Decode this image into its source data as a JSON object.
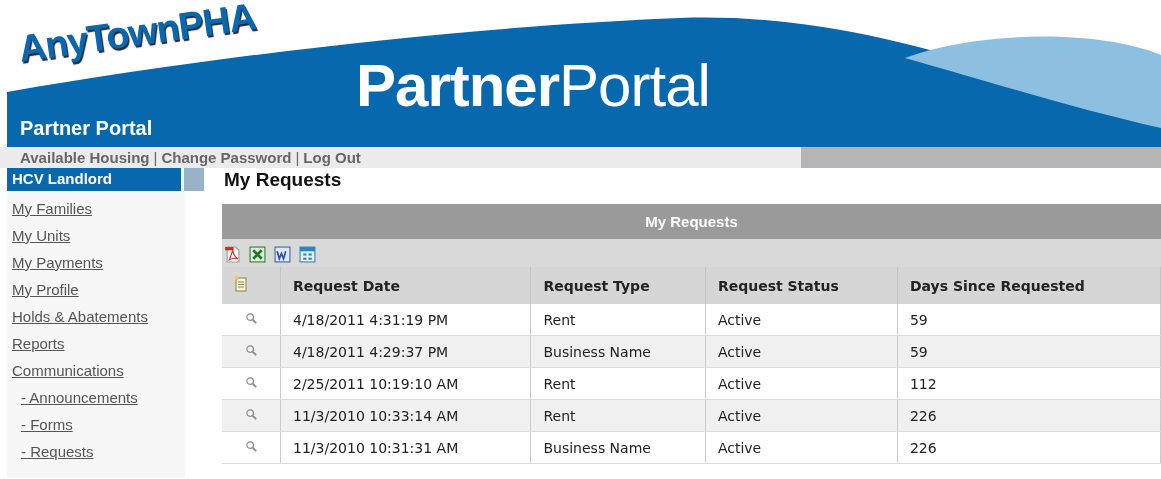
{
  "header": {
    "logo": "AnyTownPHA",
    "title_bold": "Partner",
    "title_light": "Portal",
    "subtitle": "Partner Portal"
  },
  "nav": {
    "links": [
      "Available Housing",
      "Change Password",
      "Log Out"
    ],
    "separator": "|"
  },
  "sidebar": {
    "title": "HCV Landlord",
    "items": [
      {
        "label": "My Families"
      },
      {
        "label": "My Units"
      },
      {
        "label": "My Payments"
      },
      {
        "label": "My Profile"
      },
      {
        "label": "Holds & Abatements"
      },
      {
        "label": "Reports"
      },
      {
        "label": "Communications",
        "children": [
          {
            "label": "- Announcements"
          },
          {
            "label": "- Forms"
          },
          {
            "label": "- Requests"
          }
        ]
      }
    ]
  },
  "page_title": "My Requests",
  "table": {
    "caption": "My Requests",
    "export_tools": [
      {
        "kind": "pdf"
      },
      {
        "kind": "excel"
      },
      {
        "kind": "word"
      },
      {
        "kind": "table"
      }
    ],
    "columns": [
      "Request Date",
      "Request Type",
      "Request Status",
      "Days Since Requested"
    ],
    "rows": [
      [
        "4/18/2011 4:31:19 PM",
        "Rent",
        "Active",
        "59"
      ],
      [
        "4/18/2011 4:29:37 PM",
        "Business Name",
        "Active",
        "59"
      ],
      [
        "2/25/2011 10:19:10 AM",
        "Rent",
        "Active",
        "112"
      ],
      [
        "11/3/2010 10:33:14 AM",
        "Rent",
        "Active",
        "226"
      ],
      [
        "11/3/2010 10:31:31 AM",
        "Business Name",
        "Active",
        "226"
      ]
    ]
  }
}
